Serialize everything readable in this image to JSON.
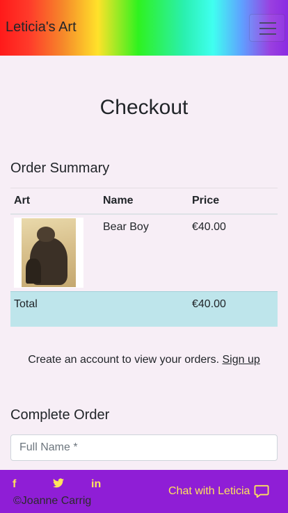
{
  "navbar": {
    "brand": "Leticia's Art",
    "toggler_icon": "hamburger-icon"
  },
  "page": {
    "title": "Checkout"
  },
  "order_summary": {
    "title": "Order Summary",
    "columns": [
      "Art",
      "Name",
      "Price"
    ],
    "items": [
      {
        "name": "Bear Boy",
        "price": "€40.00",
        "image_icon": "artwork-thumbnail"
      }
    ],
    "total_label": "Total",
    "total_value": "€40.00"
  },
  "account": {
    "text": "Create an account to view your orders.",
    "signup_link": "Sign up"
  },
  "complete_order": {
    "title": "Complete Order",
    "full_name_placeholder": "Full Name *"
  },
  "footer": {
    "social": {
      "facebook": "f",
      "twitter_icon": "twitter-icon",
      "linkedin": "in"
    },
    "copyright": "©Joanne Carrig",
    "chat_label": "Chat with Leticia",
    "chat_icon": "chat-bubble-icon"
  },
  "colors": {
    "page_background": "#f7eef6",
    "total_row": "#bee5eb",
    "footer_background": "#8f1ed6",
    "footer_text": "#ffe45c"
  }
}
